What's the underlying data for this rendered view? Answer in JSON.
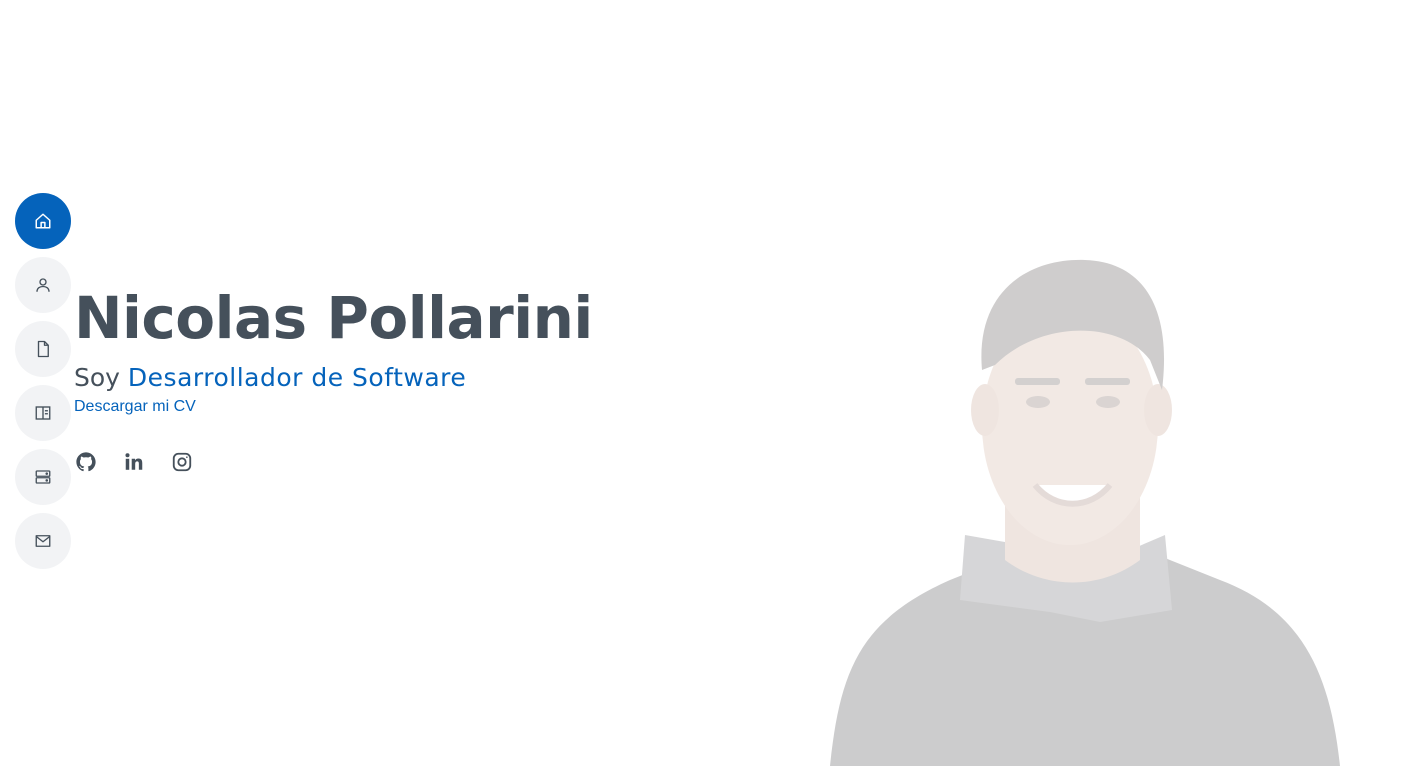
{
  "colors": {
    "accent": "#0563bb",
    "text": "#45505b",
    "nav_bg": "#f2f3f5"
  },
  "nav": {
    "items": [
      {
        "icon": "home-icon",
        "active": true
      },
      {
        "icon": "user-icon",
        "active": false
      },
      {
        "icon": "file-icon",
        "active": false
      },
      {
        "icon": "book-icon",
        "active": false
      },
      {
        "icon": "server-icon",
        "active": false
      },
      {
        "icon": "envelope-icon",
        "active": false
      }
    ]
  },
  "hero": {
    "name": "Nicolas Pollarini",
    "role_prefix": "Soy ",
    "role_typed": "Desarrollador de Software",
    "cv_link": "Descargar mi CV"
  },
  "social": {
    "items": [
      {
        "icon": "github-icon"
      },
      {
        "icon": "linkedin-icon"
      },
      {
        "icon": "instagram-icon"
      }
    ]
  }
}
